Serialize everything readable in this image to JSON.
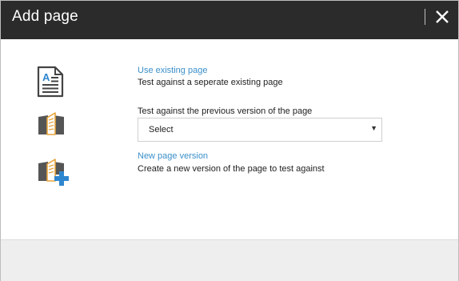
{
  "dialog": {
    "title": "Add page",
    "close_icon": "close-icon"
  },
  "options": {
    "existing": {
      "icon": "document-icon",
      "link_label": "Use existing page",
      "description": "Test against a seperate existing page"
    },
    "previous": {
      "icon": "book-icon",
      "description": "Test against the previous version of the page",
      "select_value": "Select",
      "caret_icon": "chevron-down-icon"
    },
    "new_version": {
      "icon": "book-add-icon",
      "link_label": "New page version",
      "description": "Create a new version of the page to test against"
    }
  },
  "colors": {
    "header_bg": "#2b2b2b",
    "link": "#3a8fc9",
    "accent_blue": "#2f86d0",
    "book_gold": "#e8a33b"
  }
}
